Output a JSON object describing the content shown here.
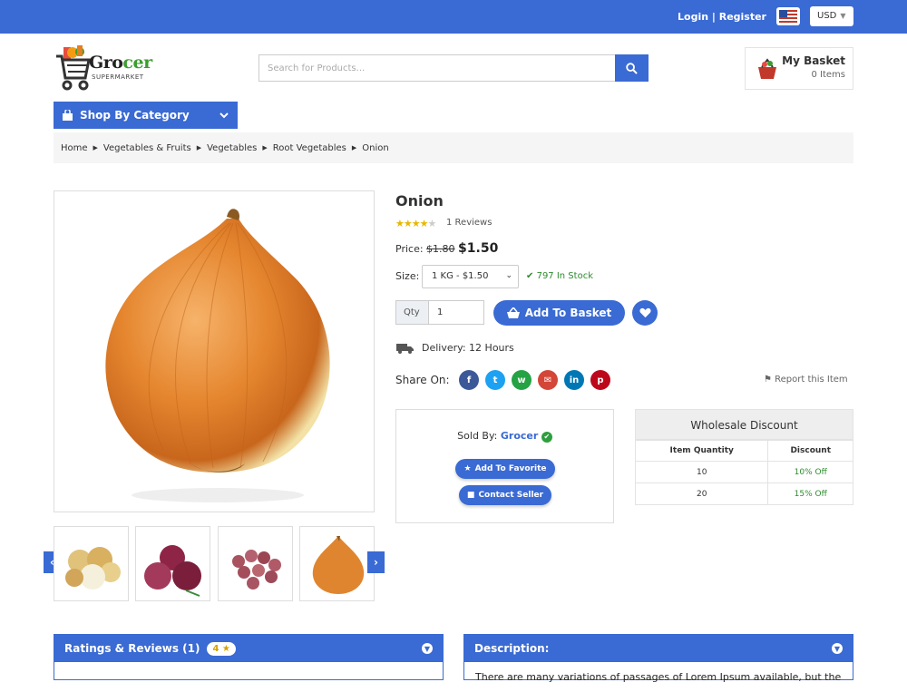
{
  "topbar": {
    "login": "Login | Register",
    "currency": "USD"
  },
  "brand": {
    "name_a": "Gro",
    "name_b": "cer",
    "tagline": "SUPERMARKET"
  },
  "search": {
    "placeholder": "Search for Products..."
  },
  "basket": {
    "title": "My Basket",
    "count": "0 Items"
  },
  "category_button": "Shop By Category",
  "breadcrumb": [
    "Home",
    "Vegetables & Fruits",
    "Vegetables",
    "Root Vegetables",
    "Onion"
  ],
  "product": {
    "title": "Onion",
    "rating": 4,
    "reviews": "1 Reviews",
    "price_label": "Price:",
    "old_price": "$1.80",
    "price": "$1.50",
    "size_label": "Size:",
    "size_value": "1 KG - $1.50",
    "stock": "797 In Stock",
    "qty_label": "Qty",
    "qty_value": "1",
    "add_label": "Add To Basket",
    "delivery": "Delivery: 12 Hours",
    "share_label": "Share On:",
    "report": "Report this Item"
  },
  "social": [
    {
      "icon": "facebook-icon",
      "glyph": "f",
      "color": "#3b5998"
    },
    {
      "icon": "twitter-icon",
      "glyph": "t",
      "color": "#1da1f2"
    },
    {
      "icon": "whatsapp-icon",
      "glyph": "w",
      "color": "#25a244"
    },
    {
      "icon": "email-icon",
      "glyph": "✉",
      "color": "#d44638"
    },
    {
      "icon": "linkedin-icon",
      "glyph": "in",
      "color": "#0077b5"
    },
    {
      "icon": "pinterest-icon",
      "glyph": "p",
      "color": "#bd081c"
    }
  ],
  "seller": {
    "prefix": "Sold By:",
    "name": "Grocer",
    "fav": "Add To Favorite",
    "contact": "Contact Seller"
  },
  "wholesale": {
    "title": "Wholesale Discount",
    "headers": [
      "Item Quantity",
      "Discount"
    ],
    "rows": [
      [
        "10",
        "10% Off"
      ],
      [
        "20",
        "15% Off"
      ]
    ]
  },
  "panels": {
    "ratings": "Ratings & Reviews (1)",
    "ratings_badge": "4",
    "description": "Description:",
    "description_text": "There are many variations of passages of Lorem Ipsum available, but the"
  },
  "colors": {
    "primary": "#3a6ad3",
    "success": "#2e8b2e",
    "star": "#e6b800"
  }
}
